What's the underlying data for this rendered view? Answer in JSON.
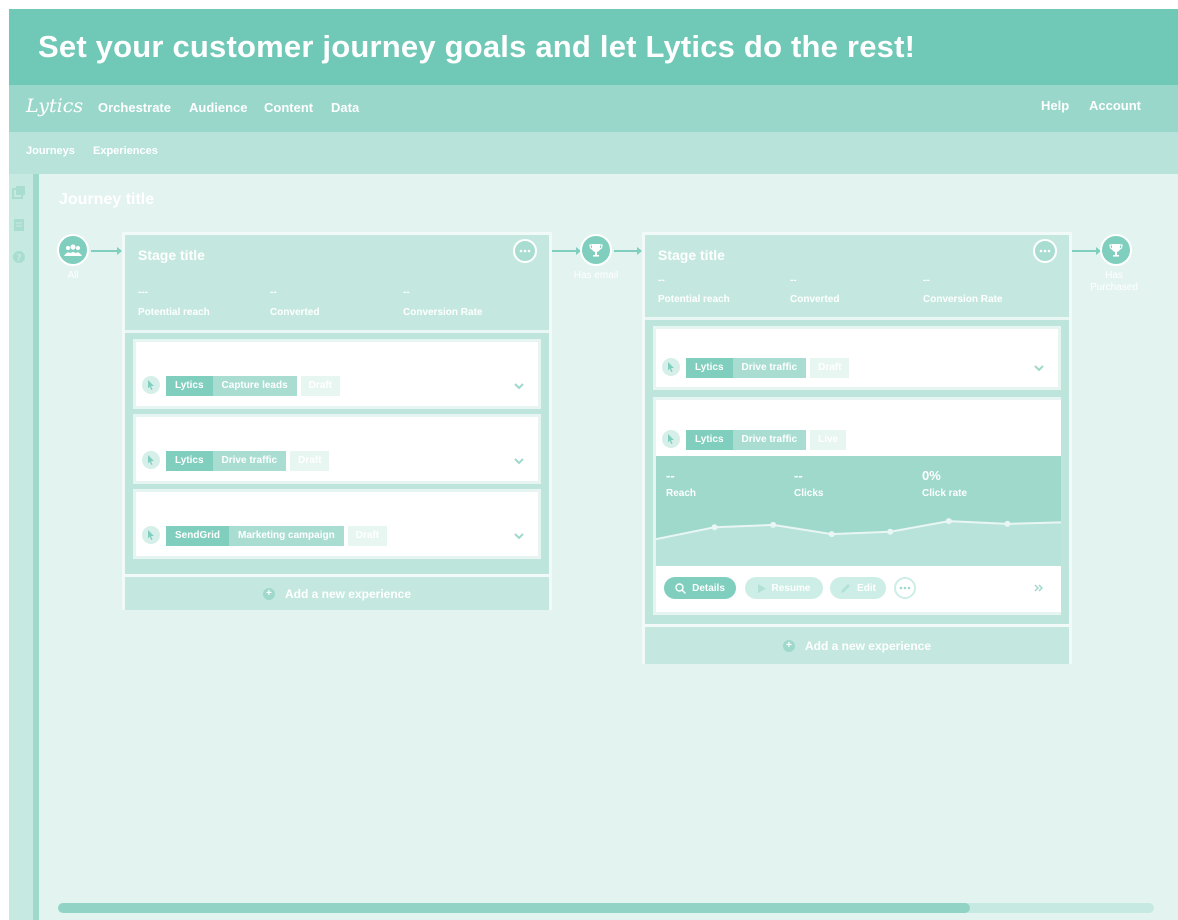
{
  "banner": {
    "headline": "Set your customer journey goals and let Lytics do the rest!"
  },
  "nav": {
    "logo": "Lytics",
    "items": [
      "Orchestrate",
      "Audience",
      "Content",
      "Data"
    ],
    "right": [
      "Help",
      "Account"
    ]
  },
  "subnav": {
    "items": [
      "Journeys",
      "Experiences"
    ]
  },
  "journey": {
    "title": "Journey title",
    "nodes": [
      {
        "label": "All",
        "icon": "users-icon"
      },
      {
        "label": "Has email",
        "icon": "trophy-icon"
      },
      {
        "label": "Has Purchased",
        "icon": "trophy-icon"
      }
    ]
  },
  "stages": [
    {
      "title": "Stage title",
      "stats": [
        {
          "value": "---",
          "label": "Potential reach"
        },
        {
          "value": "--",
          "label": "Converted"
        },
        {
          "value": "--",
          "label": "Conversion Rate"
        }
      ],
      "experiences": [
        {
          "provider": "Lytics",
          "goal": "Capture leads",
          "status": "Draft"
        },
        {
          "provider": "Lytics",
          "goal": "Drive traffic",
          "status": "Draft"
        },
        {
          "provider": "SendGrid",
          "goal": "Marketing campaign",
          "status": "Draft"
        }
      ],
      "add_label": "Add a new experience"
    },
    {
      "title": "Stage title",
      "stats": [
        {
          "value": "--",
          "label": "Potential reach"
        },
        {
          "value": "--",
          "label": "Converted"
        },
        {
          "value": "--",
          "label": "Conversion Rate"
        }
      ],
      "experiences": [
        {
          "provider": "Lytics",
          "goal": "Drive traffic",
          "status": "Draft"
        },
        {
          "provider": "Lytics",
          "goal": "Drive traffic",
          "status": "Live",
          "metrics": [
            {
              "value": "--",
              "label": "Reach"
            },
            {
              "value": "--",
              "label": "Clicks"
            },
            {
              "value": "0%",
              "label": "Click rate"
            }
          ],
          "trend": [
            0.2,
            0.55,
            0.62,
            0.35,
            0.42,
            0.73,
            0.65,
            0.7
          ],
          "actions": {
            "details": "Details",
            "resume": "Resume",
            "edit": "Edit"
          }
        }
      ],
      "add_label": "Add a new experience"
    }
  ],
  "colors": {
    "banner": "#70c8b7",
    "nav": "#99d7ca",
    "canvas": "#e3f3ef",
    "accent": "#7fcebe"
  }
}
